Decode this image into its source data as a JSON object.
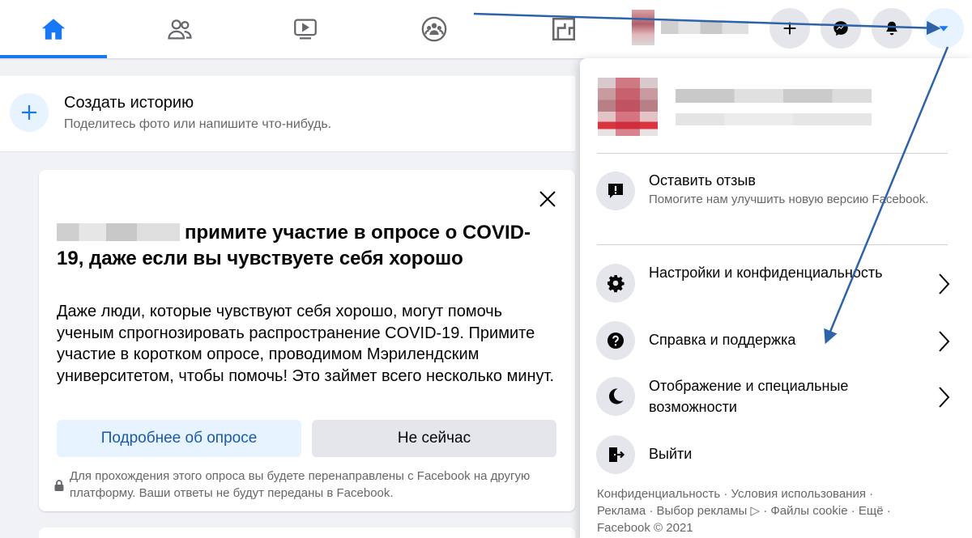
{
  "topbar": {
    "tabs": [
      {
        "name": "home",
        "icon": "home-icon"
      },
      {
        "name": "friends",
        "icon": "friends-icon"
      },
      {
        "name": "watch",
        "icon": "video-icon"
      },
      {
        "name": "groups",
        "icon": "groups-icon"
      },
      {
        "name": "gaming",
        "icon": "gaming-icon"
      }
    ],
    "actions": [
      "plus-icon",
      "messenger-icon",
      "bell-icon",
      "caret-down-icon"
    ],
    "active_color": "#1877f2"
  },
  "story": {
    "title": "Создать историю",
    "subtitle": "Поделитесь фото или напишите что-нибудь."
  },
  "survey": {
    "title_rest": "примите участие в опросе о COVID-19, даже если вы чувствуете себя хорошо",
    "body": "Даже люди, которые чувствуют себя хорошо, могут помочь ученым спрогнозировать распространение COVID-19. Примите участие в коротком опросе, проводимом Мэрилендским университетом, чтобы помочь! Это займет всего несколько минут.",
    "primary_button": "Подробнее об опросе",
    "secondary_button": "Не сейчас",
    "note": "Для прохождения этого опроса вы будете перенаправлены с Facebook на другую платформу. Ваши ответы не будут переданы в Facebook."
  },
  "menu": {
    "feedback": {
      "title": "Оставить отзыв",
      "subtitle": "Помогите нам улучшить новую версию Facebook."
    },
    "items": [
      {
        "label": "Настройки и конфиденциальность",
        "icon": "gear-icon"
      },
      {
        "label": "Справка и поддержка",
        "icon": "help-icon"
      },
      {
        "label": "Отображение и специальные возможности",
        "icon": "moon-icon"
      },
      {
        "label": "Выйти",
        "icon": "logout-icon"
      }
    ],
    "footer": {
      "line1": "Конфиденциальность · Условия использования ·",
      "line2": "Реклама · Выбор рекламы ▷ · Файлы cookie · Ещё ·",
      "line3": "Facebook © 2021"
    }
  },
  "annotation_color": "#2d63a8"
}
